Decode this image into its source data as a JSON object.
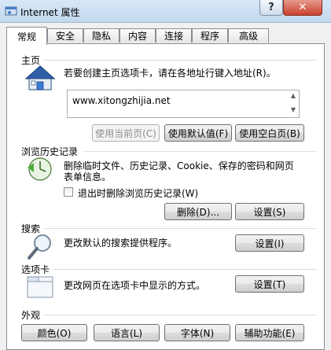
{
  "window": {
    "title": "Internet 属性",
    "help_label": "?",
    "close_label": "✕"
  },
  "tabs": [
    "常规",
    "安全",
    "隐私",
    "内容",
    "连接",
    "程序",
    "高级"
  ],
  "homepage": {
    "heading": "主页",
    "instruction": "若要创建主页选项卡，请在各地址行键入地址(R)。",
    "url": "www.xitongzhijia.net",
    "use_current": "使用当前页(C)",
    "use_default": "使用默认值(F)",
    "use_blank": "使用空白页(B)"
  },
  "history": {
    "heading": "浏览历史记录",
    "desc_line1": "删除临时文件、历史记录、Cookie、保存的密码和网页",
    "desc_line2": "表单信息。",
    "checkbox_label": "退出时删除浏览历史记录(W)",
    "delete_button": "删除(D)...",
    "settings_button": "设置(S)"
  },
  "search": {
    "heading": "搜索",
    "desc": "更改默认的搜索提供程序。",
    "settings_button": "设置(I)"
  },
  "tabbed": {
    "heading": "选项卡",
    "desc": "更改网页在选项卡中显示的方式。",
    "settings_button": "设置(T)"
  },
  "appearance": {
    "heading": "外观",
    "colors": "颜色(O)",
    "languages": "语言(L)",
    "fonts": "字体(N)",
    "accessibility": "辅助功能(E)"
  },
  "colors": {
    "accent": "#3a7bd5",
    "panel_border": "#898c95"
  }
}
